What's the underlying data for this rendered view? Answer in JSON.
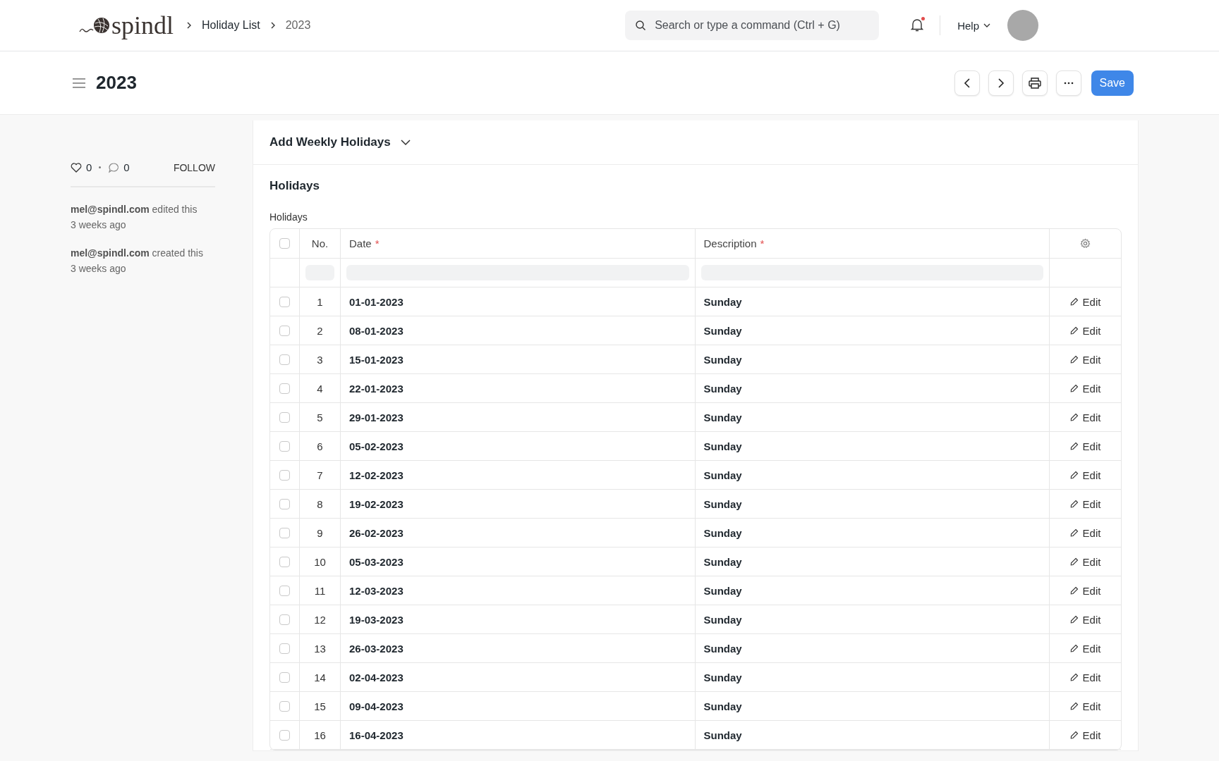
{
  "nav": {
    "logo": "spindl",
    "breadcrumbs": [
      "Holiday List",
      "2023"
    ],
    "search": {
      "placeholder": "Search or type a command (Ctrl + G)"
    },
    "notifications": {
      "unread": true
    },
    "help": "Help"
  },
  "page": {
    "title": "2023",
    "save": "Save"
  },
  "sidebar": {
    "likes": "0",
    "comments": "0",
    "follow": "FOLLOW",
    "activity": [
      {
        "text": "**mel@spindl.com** edited this",
        "time": "3 weeks ago"
      },
      {
        "text": "**mel@spindl.com** created this",
        "time": "3 weeks ago"
      }
    ]
  },
  "weekly_section": {
    "title": "Add Weekly Holidays",
    "expanded": false
  },
  "holidays_section": {
    "title": "Holidays",
    "table_label": "Holidays",
    "select_all_checked": false,
    "columns": [
      {
        "label": "No."
      },
      {
        "label": "Date",
        "required_mark": "*"
      },
      {
        "label": "Description",
        "required_mark": "*"
      }
    ],
    "rows": [
      {
        "no": "1",
        "date": "01-01-2023",
        "description": "Sunday",
        "checked": false,
        "edit": "Edit"
      },
      {
        "no": "2",
        "date": "08-01-2023",
        "description": "Sunday",
        "checked": false,
        "edit": "Edit"
      },
      {
        "no": "3",
        "date": "15-01-2023",
        "description": "Sunday",
        "checked": false,
        "edit": "Edit"
      },
      {
        "no": "4",
        "date": "22-01-2023",
        "description": "Sunday",
        "checked": false,
        "edit": "Edit"
      },
      {
        "no": "5",
        "date": "29-01-2023",
        "description": "Sunday",
        "checked": false,
        "edit": "Edit"
      },
      {
        "no": "6",
        "date": "05-02-2023",
        "description": "Sunday",
        "checked": false,
        "edit": "Edit"
      },
      {
        "no": "7",
        "date": "12-02-2023",
        "description": "Sunday",
        "checked": false,
        "edit": "Edit"
      },
      {
        "no": "8",
        "date": "19-02-2023",
        "description": "Sunday",
        "checked": false,
        "edit": "Edit"
      },
      {
        "no": "9",
        "date": "26-02-2023",
        "description": "Sunday",
        "checked": false,
        "edit": "Edit"
      },
      {
        "no": "10",
        "date": "05-03-2023",
        "description": "Sunday",
        "checked": false,
        "edit": "Edit"
      },
      {
        "no": "11",
        "date": "12-03-2023",
        "description": "Sunday",
        "checked": false,
        "edit": "Edit"
      },
      {
        "no": "12",
        "date": "19-03-2023",
        "description": "Sunday",
        "checked": false,
        "edit": "Edit"
      },
      {
        "no": "13",
        "date": "26-03-2023",
        "description": "Sunday",
        "checked": false,
        "edit": "Edit"
      },
      {
        "no": "14",
        "date": "02-04-2023",
        "description": "Sunday",
        "checked": false,
        "edit": "Edit"
      },
      {
        "no": "15",
        "date": "09-04-2023",
        "description": "Sunday",
        "checked": false,
        "edit": "Edit"
      },
      {
        "no": "16",
        "date": "16-04-2023",
        "description": "Sunday",
        "checked": false,
        "edit": "Edit"
      }
    ]
  }
}
